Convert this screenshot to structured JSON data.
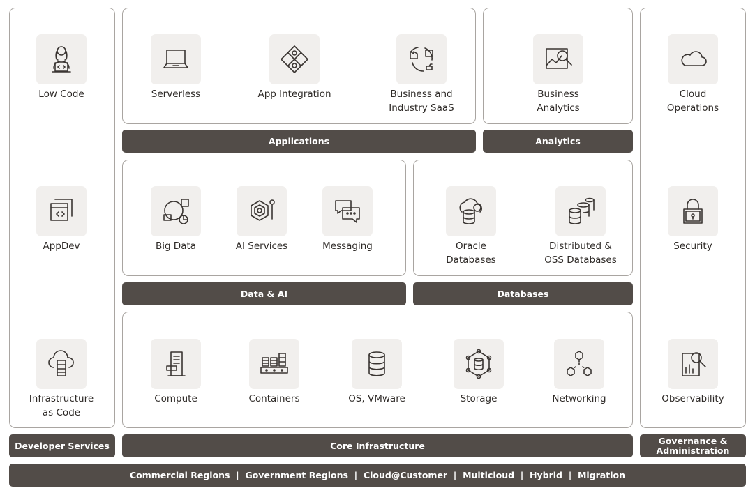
{
  "colors": {
    "bar": "#524c48",
    "tile": "#f1efed",
    "border": "#a9a5a1"
  },
  "bars": {
    "applications": "Applications",
    "analytics": "Analytics",
    "data_ai": "Data & AI",
    "databases": "Databases",
    "core": "Core Infrastructure",
    "developer": "Developer Services",
    "governance": "Governance &\nAdministration",
    "regions": "Commercial Regions  |  Government Regions  |  Cloud@Customer  |  Multicloud  |  Hybrid  |  Migration"
  },
  "services": {
    "low_code": {
      "label": "Low Code",
      "icon": "developer-laptop-icon"
    },
    "appdev": {
      "label": "AppDev",
      "icon": "code-window-icon"
    },
    "iac": {
      "label": "Infrastructure\nas Code",
      "icon": "cloud-server-icon"
    },
    "serverless": {
      "label": "Serverless",
      "icon": "laptop-icon"
    },
    "app_integration": {
      "label": "App Integration",
      "icon": "puzzle-icon"
    },
    "saas": {
      "label": "Business and\nIndustry SaaS",
      "icon": "factory-cycle-icon"
    },
    "analytics": {
      "label": "Business\nAnalytics",
      "icon": "chart-magnifier-icon"
    },
    "cloud_ops": {
      "label": "Cloud\nOperations",
      "icon": "cloud-icon"
    },
    "big_data": {
      "label": "Big Data",
      "icon": "globe-charts-icon"
    },
    "ai": {
      "label": "AI Services",
      "icon": "neural-web-icon"
    },
    "messaging": {
      "label": "Messaging",
      "icon": "chat-bubbles-icon"
    },
    "oracle_db": {
      "label": "Oracle\nDatabases",
      "icon": "autonomous-db-icon"
    },
    "dist_db": {
      "label": "Distributed &\nOSS Databases",
      "icon": "multi-database-icon"
    },
    "security": {
      "label": "Security",
      "icon": "padlock-icon"
    },
    "compute": {
      "label": "Compute",
      "icon": "server-icon"
    },
    "containers": {
      "label": "Containers",
      "icon": "containers-icon"
    },
    "os": {
      "label": "OS, VMware",
      "icon": "database-icon"
    },
    "storage": {
      "label": "Storage",
      "icon": "storage-network-icon"
    },
    "networking": {
      "label": "Networking",
      "icon": "network-cubes-icon"
    },
    "observability": {
      "label": "Observability",
      "icon": "report-magnifier-icon"
    }
  }
}
